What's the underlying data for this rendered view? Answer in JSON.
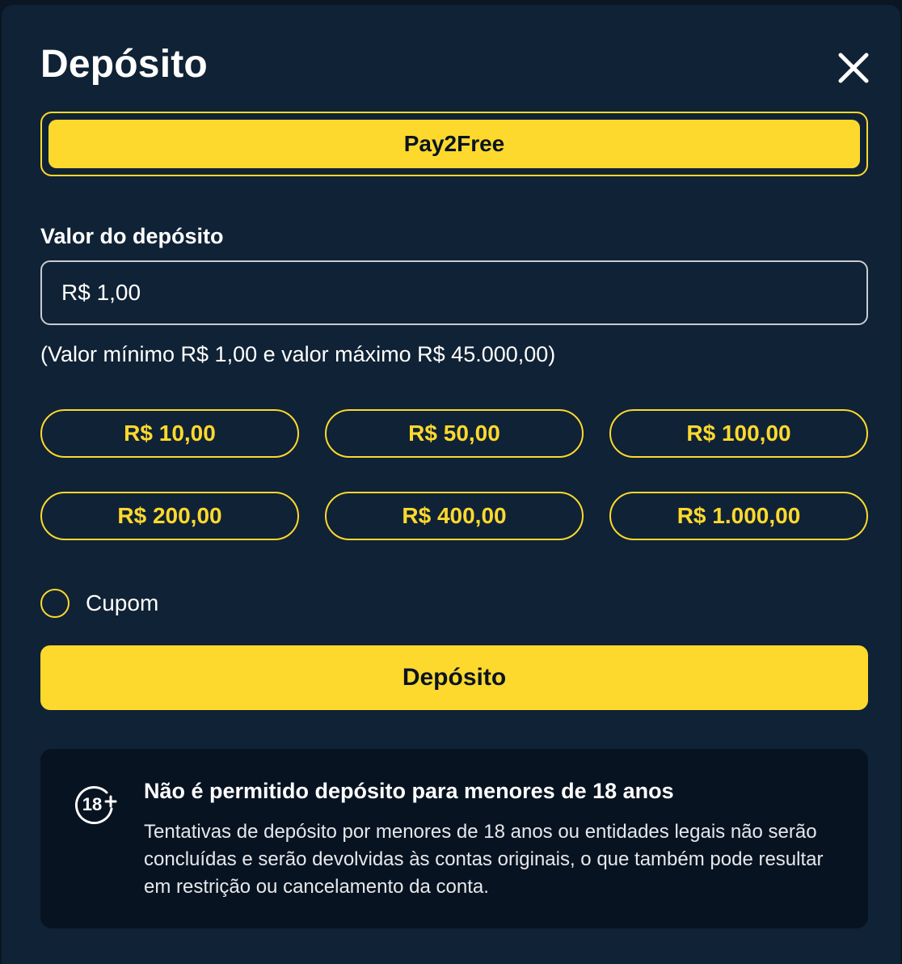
{
  "modal": {
    "title": "Depósito",
    "close_icon": "close-icon"
  },
  "payment_method": {
    "selected": "Pay2Free"
  },
  "amount": {
    "label": "Valor do depósito",
    "value": "R$ 1,00",
    "limits_text": "(Valor mínimo R$ 1,00 e valor máximo R$ 45.000,00)"
  },
  "quick_amounts": [
    "R$ 10,00",
    "R$ 50,00",
    "R$ 100,00",
    "R$ 200,00",
    "R$ 400,00",
    "R$ 1.000,00"
  ],
  "coupon": {
    "label": "Cupom",
    "checked": false
  },
  "submit": {
    "label": "Depósito"
  },
  "notice": {
    "icon": "age-18-plus-icon",
    "icon_text": "18",
    "title": "Não é permitido depósito para menores de 18 anos",
    "body": "Tentativas de depósito por menores de 18 anos ou entidades legais não serão concluídas e serão devolvidas às contas originais, o que também pode resultar em restrição ou cancelamento da conta."
  },
  "colors": {
    "accent": "#fdd92e",
    "modal_bg": "#102235",
    "notice_bg": "#081321"
  }
}
